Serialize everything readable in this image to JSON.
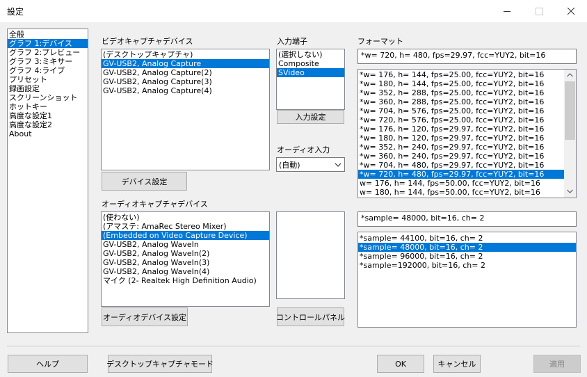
{
  "window": {
    "title": "設定"
  },
  "nav": {
    "items": [
      "全般",
      "グラフ 1:デバイス",
      "グラフ 2:プレビュー",
      "グラフ 3:ミキサー",
      "グラフ 4:ライブ",
      "プリセット",
      "録画設定",
      "スクリーンショット",
      "ホットキー",
      "高度な設定1",
      "高度な設定2",
      "About"
    ],
    "selected_index": 1
  },
  "video_device": {
    "label": "ビデオキャプチャデバイス",
    "items": [
      "(デスクトップキャプチャ)",
      "GV-USB2, Analog Capture",
      "GV-USB2, Analog Capture(2)",
      "GV-USB2, Analog Capture(3)",
      "GV-USB2, Analog Capture(4)"
    ],
    "selected_index": 1,
    "settings_button": "デバイス設定"
  },
  "input_terminal": {
    "label": "入力端子",
    "items": [
      "(選択しない)",
      "Composite",
      "SVideo"
    ],
    "selected_index": 2,
    "settings_button": "入力設定"
  },
  "audio_input": {
    "label": "オーディオ入力",
    "value": "(自動)"
  },
  "format": {
    "label": "フォーマット",
    "current": "*w= 720, h= 480, fps=29.97,  fcc=YUY2, bit=16",
    "items": [
      "*w= 176, h= 144, fps=25.00,  fcc=YUY2, bit=16",
      "*w= 180, h= 144, fps=25.00,  fcc=YUY2, bit=16",
      "*w= 352, h= 288, fps=25.00,  fcc=YUY2, bit=16",
      "*w= 360, h= 288, fps=25.00,  fcc=YUY2, bit=16",
      "*w= 704, h= 576, fps=25.00,  fcc=YUY2, bit=16",
      "*w= 720, h= 576, fps=25.00,  fcc=YUY2, bit=16",
      "*w= 176, h= 120, fps=29.97,  fcc=YUY2, bit=16",
      "*w= 180, h= 120, fps=29.97,  fcc=YUY2, bit=16",
      "*w= 352, h= 240, fps=29.97,  fcc=YUY2, bit=16",
      "*w= 360, h= 240, fps=29.97,  fcc=YUY2, bit=16",
      "*w= 704, h= 480, fps=29.97,  fcc=YUY2, bit=16",
      "*w= 720, h= 480, fps=29.97,  fcc=YUY2, bit=16",
      "w= 176, h= 144, fps=50.00,  fcc=YUY2, bit=16",
      "w= 180, h= 144, fps=50.00,  fcc=YUY2, bit=16"
    ],
    "selected_index": 11
  },
  "audio_device": {
    "label": "オーディオキャプチャデバイス",
    "items": [
      "(使わない)",
      "(アマステ: AmaRec Stereo Mixer)",
      "(Embedded on Video Capture Device)",
      "GV-USB2, Analog WaveIn",
      "GV-USB2, Analog WaveIn(2)",
      "GV-USB2, Analog WaveIn(3)",
      "GV-USB2, Analog WaveIn(4)",
      "マイク (2- Realtek High Definition Audio)"
    ],
    "selected_index": 2,
    "settings_button": "オーディオデバイス設定"
  },
  "control_panel_button": "コントロールパネル",
  "audio_format": {
    "current": "*sample= 48000, bit=16, ch= 2",
    "items": [
      "*sample= 44100, bit=16, ch= 2",
      "*sample= 48000, bit=16, ch= 2",
      "*sample= 96000, bit=16, ch= 2",
      "*sample=192000, bit=16, ch= 2"
    ],
    "selected_index": 1
  },
  "footer": {
    "help": "ヘルプ",
    "desktop_mode": "デスクトップキャプチャモード",
    "ok": "OK",
    "cancel": "キャンセル",
    "apply": "適用"
  },
  "colors": {
    "selection": "#0078d7",
    "background": "#f0f0f0"
  }
}
